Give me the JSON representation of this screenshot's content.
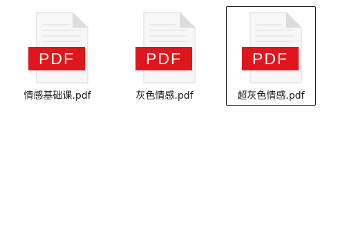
{
  "files": [
    {
      "name": "情感基础课.pdf",
      "badge": "PDF",
      "selected": false
    },
    {
      "name": "灰色情感.pdf",
      "badge": "PDF",
      "selected": false
    },
    {
      "name": "超灰色情感.pdf",
      "badge": "PDF",
      "selected": true
    }
  ],
  "icon": "pdf-file-icon",
  "colors": {
    "badge_red": "#e0161e",
    "page_white": "#f7f7f7",
    "fold_grey": "#d6d6d6",
    "selection_border": "#1f1f1f"
  }
}
